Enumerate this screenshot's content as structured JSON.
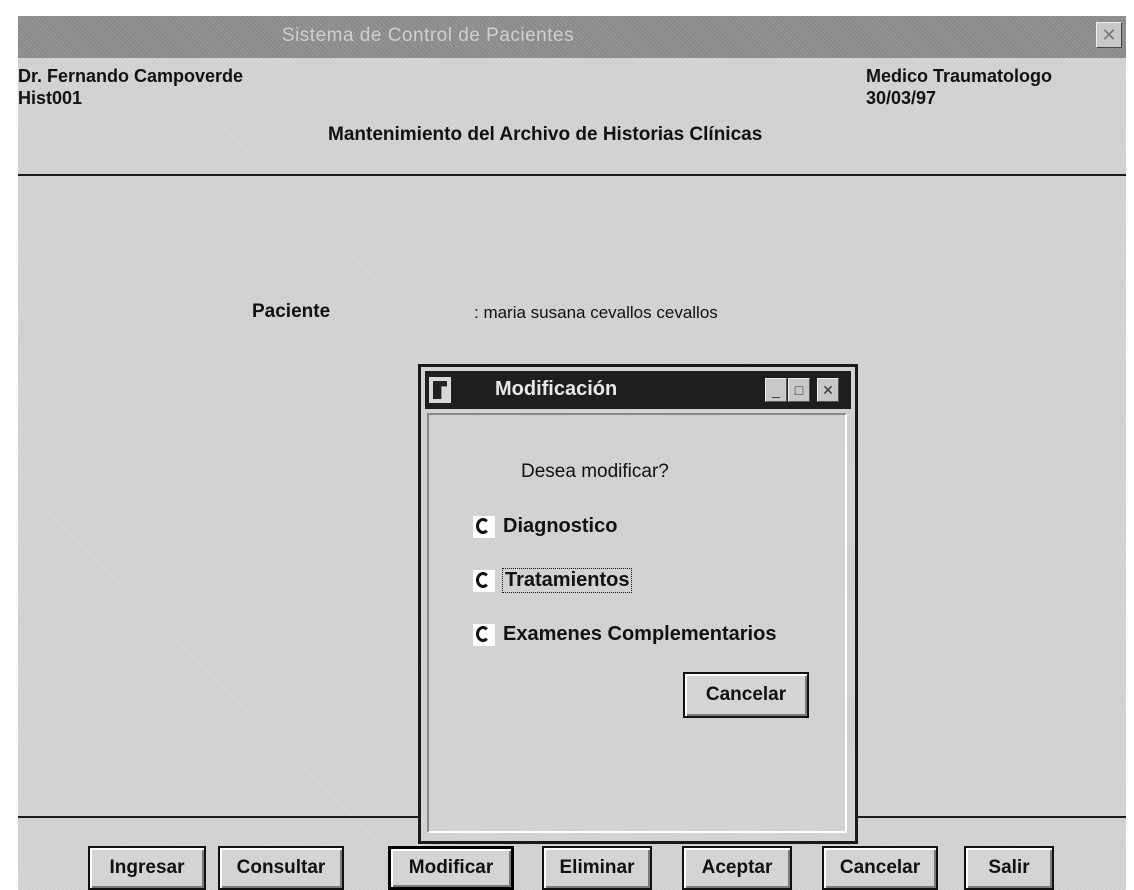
{
  "window": {
    "title": "Sistema de Control de Pacientes",
    "close_glyph": "✕"
  },
  "header": {
    "doctor": "Dr. Fernando Campoverde",
    "form_code": "Hist001",
    "specialty": "Medico Traumatologo",
    "date": "30/03/97",
    "subtitle": "Mantenimiento del Archivo de Historias Clínicas"
  },
  "patient": {
    "label": "Paciente",
    "value": ": maria susana  cevallos cevallos"
  },
  "dialog": {
    "title": "Modificación",
    "prompt": "Desea modificar?",
    "options": [
      {
        "label": "Diagnostico"
      },
      {
        "label": "Tratamientos"
      },
      {
        "label": "Examenes Complementarios"
      }
    ],
    "cancel_label": "Cancelar",
    "min_glyph": "_",
    "max_glyph": "□",
    "close_glyph": "✕"
  },
  "toolbar": {
    "buttons": [
      {
        "label": "Ingresar"
      },
      {
        "label": "Consultar"
      },
      {
        "label": "Modificar"
      },
      {
        "label": "Eliminar"
      },
      {
        "label": "Aceptar"
      },
      {
        "label": "Cancelar"
      },
      {
        "label": "Salir"
      }
    ]
  },
  "icons": {
    "dialog_icon": "app-icon"
  }
}
